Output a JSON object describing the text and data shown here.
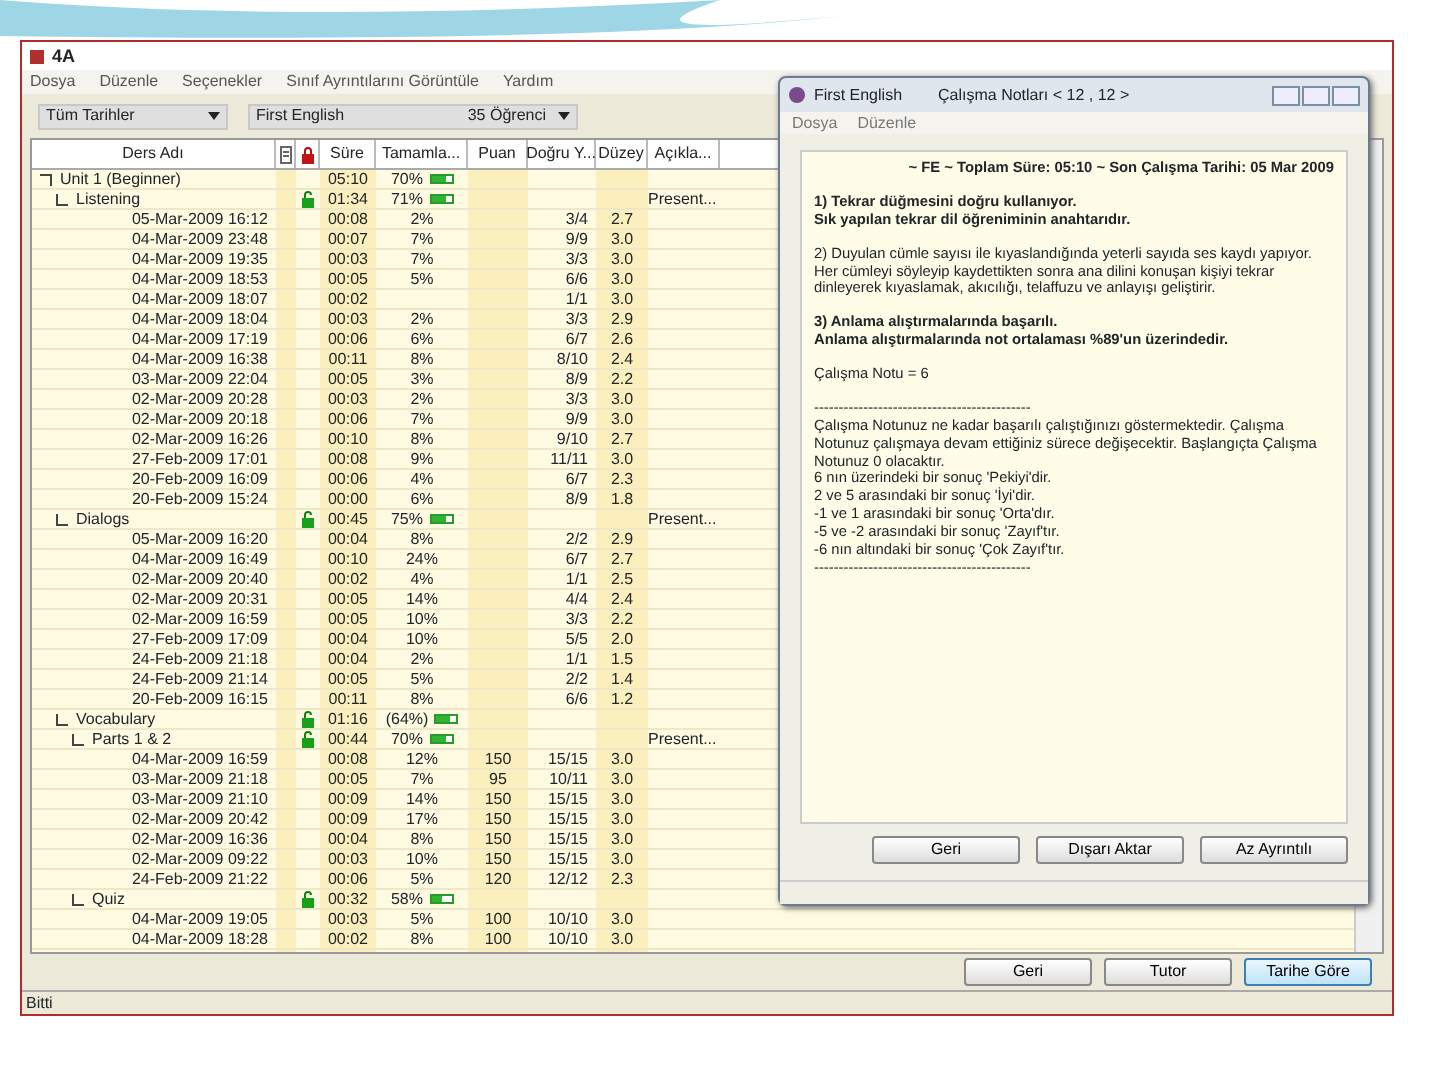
{
  "window": {
    "title": "4A",
    "menu": [
      "Dosya",
      "Düzenle",
      "Seçenekler",
      "Sınıf Ayrıntılarını Görüntüle",
      "Yardım"
    ],
    "filters": [
      {
        "value": "Tüm Tarihler"
      },
      {
        "value": "First English",
        "extra": "35 Öğrenci"
      }
    ],
    "table": {
      "columns": [
        {
          "kind": "text",
          "label": "Ders Adı"
        },
        {
          "kind": "notes"
        },
        {
          "kind": "lock"
        },
        {
          "kind": "text",
          "label": "Süre"
        },
        {
          "kind": "text",
          "label": "Tamamla..."
        },
        {
          "kind": "text",
          "label": "Puan"
        },
        {
          "kind": "text",
          "label": "Doğru Y..."
        },
        {
          "kind": "text",
          "label": "Düzey"
        },
        {
          "kind": "text",
          "label": "Açıkla..."
        }
      ],
      "rows": [
        {
          "kind": "group",
          "name": "Unit 1 (Beginner)",
          "padlock": false,
          "duration": "05:10",
          "complete": "70%",
          "level": 0.7,
          "children": [
            {
              "kind": "group",
              "name": "Listening",
              "padlock": true,
              "duration": "01:34",
              "complete": "71%",
              "level": 0.71,
              "description": "Present...",
              "children": [
                {
                  "kind": "session",
                  "date": "05-Mar-2009  16:12",
                  "duration": "00:08",
                  "complete": "2%",
                  "correct": "3/4",
                  "grade": "2.7"
                },
                {
                  "kind": "session",
                  "date": "04-Mar-2009  23:48",
                  "duration": "00:07",
                  "complete": "7%",
                  "correct": "9/9",
                  "grade": "3.0"
                },
                {
                  "kind": "session",
                  "date": "04-Mar-2009  19:35",
                  "duration": "00:03",
                  "complete": "7%",
                  "correct": "3/3",
                  "grade": "3.0"
                },
                {
                  "kind": "session",
                  "date": "04-Mar-2009  18:53",
                  "duration": "00:05",
                  "complete": "5%",
                  "correct": "6/6",
                  "grade": "3.0"
                },
                {
                  "kind": "session",
                  "date": "04-Mar-2009  18:07",
                  "duration": "00:02",
                  "correct": "1/1",
                  "grade": "3.0"
                },
                {
                  "kind": "session",
                  "date": "04-Mar-2009  18:04",
                  "duration": "00:03",
                  "complete": "2%",
                  "correct": "3/3",
                  "grade": "2.9"
                },
                {
                  "kind": "session",
                  "date": "04-Mar-2009  17:19",
                  "duration": "00:06",
                  "complete": "6%",
                  "correct": "6/7",
                  "grade": "2.6"
                },
                {
                  "kind": "session",
                  "date": "04-Mar-2009  16:38",
                  "duration": "00:11",
                  "complete": "8%",
                  "correct": "8/10",
                  "grade": "2.4"
                },
                {
                  "kind": "session",
                  "date": "03-Mar-2009  22:04",
                  "duration": "00:05",
                  "complete": "3%",
                  "correct": "8/9",
                  "grade": "2.2"
                },
                {
                  "kind": "session",
                  "date": "02-Mar-2009  20:28",
                  "duration": "00:03",
                  "complete": "2%",
                  "correct": "3/3",
                  "grade": "3.0"
                },
                {
                  "kind": "session",
                  "date": "02-Mar-2009  20:18",
                  "duration": "00:06",
                  "complete": "7%",
                  "correct": "9/9",
                  "grade": "3.0"
                },
                {
                  "kind": "session",
                  "date": "02-Mar-2009  16:26",
                  "duration": "00:10",
                  "complete": "8%",
                  "correct": "9/10",
                  "grade": "2.7"
                },
                {
                  "kind": "session",
                  "date": "27-Feb-2009  17:01",
                  "duration": "00:08",
                  "complete": "9%",
                  "correct": "11/11",
                  "grade": "3.0"
                },
                {
                  "kind": "session",
                  "date": "20-Feb-2009  16:09",
                  "duration": "00:06",
                  "complete": "4%",
                  "correct": "6/7",
                  "grade": "2.3"
                },
                {
                  "kind": "session",
                  "date": "20-Feb-2009  15:24",
                  "duration": "00:00",
                  "complete": "6%",
                  "correct": "8/9",
                  "grade": "1.8"
                }
              ]
            },
            {
              "kind": "group",
              "name": "Dialogs",
              "padlock": true,
              "duration": "00:45",
              "complete": "75%",
              "level": 0.75,
              "description": "Present...",
              "children": [
                {
                  "kind": "session",
                  "date": "05-Mar-2009  16:20",
                  "duration": "00:04",
                  "complete": "8%",
                  "correct": "2/2",
                  "grade": "2.9"
                },
                {
                  "kind": "session",
                  "date": "04-Mar-2009  16:49",
                  "duration": "00:10",
                  "complete": "24%",
                  "correct": "6/7",
                  "grade": "2.7"
                },
                {
                  "kind": "session",
                  "date": "02-Mar-2009  20:40",
                  "duration": "00:02",
                  "complete": "4%",
                  "correct": "1/1",
                  "grade": "2.5"
                },
                {
                  "kind": "session",
                  "date": "02-Mar-2009  20:31",
                  "duration": "00:05",
                  "complete": "14%",
                  "correct": "4/4",
                  "grade": "2.4"
                },
                {
                  "kind": "session",
                  "date": "02-Mar-2009  16:59",
                  "duration": "00:05",
                  "complete": "10%",
                  "correct": "3/3",
                  "grade": "2.2"
                },
                {
                  "kind": "session",
                  "date": "27-Feb-2009  17:09",
                  "duration": "00:04",
                  "complete": "10%",
                  "correct": "5/5",
                  "grade": "2.0"
                },
                {
                  "kind": "session",
                  "date": "24-Feb-2009  21:18",
                  "duration": "00:04",
                  "complete": "2%",
                  "correct": "1/1",
                  "grade": "1.5"
                },
                {
                  "kind": "session",
                  "date": "24-Feb-2009  21:14",
                  "duration": "00:05",
                  "complete": "5%",
                  "correct": "2/2",
                  "grade": "1.4"
                },
                {
                  "kind": "session",
                  "date": "20-Feb-2009  16:15",
                  "duration": "00:11",
                  "complete": "8%",
                  "correct": "6/6",
                  "grade": "1.2"
                }
              ]
            },
            {
              "kind": "group",
              "name": "Vocabulary",
              "padlock": true,
              "duration": "01:16",
              "complete": "(64%)",
              "level": 0.64,
              "children": [
                {
                  "kind": "group",
                  "name": "Parts 1 & 2",
                  "padlock": true,
                  "duration": "00:44",
                  "complete": "70%",
                  "level": 0.7,
                  "description": "Present...",
                  "children": [
                    {
                      "kind": "session",
                      "date": "04-Mar-2009  16:59",
                      "duration": "00:08",
                      "complete": "12%",
                      "score": "150",
                      "correct": "15/15",
                      "grade": "3.0"
                    },
                    {
                      "kind": "session",
                      "date": "03-Mar-2009  21:18",
                      "duration": "00:05",
                      "complete": "7%",
                      "score": "95",
                      "correct": "10/11",
                      "grade": "3.0"
                    },
                    {
                      "kind": "session",
                      "date": "03-Mar-2009  21:10",
                      "duration": "00:09",
                      "complete": "14%",
                      "score": "150",
                      "correct": "15/15",
                      "grade": "3.0"
                    },
                    {
                      "kind": "session",
                      "date": "02-Mar-2009  20:42",
                      "duration": "00:09",
                      "complete": "17%",
                      "score": "150",
                      "correct": "15/15",
                      "grade": "3.0"
                    },
                    {
                      "kind": "session",
                      "date": "02-Mar-2009  16:36",
                      "duration": "00:04",
                      "complete": "8%",
                      "score": "150",
                      "correct": "15/15",
                      "grade": "3.0"
                    },
                    {
                      "kind": "session",
                      "date": "02-Mar-2009  09:22",
                      "duration": "00:03",
                      "complete": "10%",
                      "score": "150",
                      "correct": "15/15",
                      "grade": "3.0"
                    },
                    {
                      "kind": "session",
                      "date": "24-Feb-2009  21:22",
                      "duration": "00:06",
                      "complete": "5%",
                      "score": "120",
                      "correct": "12/12",
                      "grade": "2.3"
                    }
                  ]
                },
                {
                  "kind": "group",
                  "name": "Quiz",
                  "padlock": true,
                  "duration": "00:32",
                  "complete": "58%",
                  "level": 0.58,
                  "children": [
                    {
                      "kind": "session",
                      "date": "04-Mar-2009  19:05",
                      "duration": "00:03",
                      "complete": "5%",
                      "score": "100",
                      "correct": "10/10",
                      "grade": "3.0"
                    },
                    {
                      "kind": "session",
                      "date": "04-Mar-2009  18:28",
                      "duration": "00:02",
                      "complete": "8%",
                      "score": "100",
                      "correct": "10/10",
                      "grade": "3.0"
                    }
                  ]
                }
              ]
            }
          ]
        }
      ]
    },
    "buttons": [
      {
        "label": "Geri",
        "selected": false
      },
      {
        "label": "Tutor",
        "selected": false
      },
      {
        "label": "Tarihe Göre",
        "selected": true
      }
    ],
    "status_bar": "Bitti"
  },
  "dialog": {
    "app_name": "First English",
    "title": "Çalışma Notları < 12 , 12 >",
    "menu": [
      "Dosya",
      "Düzenle"
    ],
    "header": "~ FE ~ Toplam Süre: 05:10 ~ Son Çalışma Tarihi: 05 Mar 2009",
    "paragraphs": [
      {
        "bold": true,
        "lines": [
          "1) Tekrar düğmesini doğru kullanıyor.",
          "Sık yapılan tekrar dil öğreniminin anahtarıdır."
        ]
      },
      {
        "bold": false,
        "lines": [
          "2) Duyulan cümle sayısı ile kıyaslandığında yeterli sayıda ses kaydı yapıyor.",
          "Her cümleyi söyleyip kaydettikten sonra ana dilini konuşan kişiyi tekrar dinleyerek kıyaslamak, akıcılığı, telaffuzu ve anlayışı geliştirir."
        ]
      },
      {
        "bold": true,
        "lines": [
          "3) Anlama alıştırmalarında başarılı.",
          "Anlama alıştırmalarında not ortalaması %89'un üzerindedir."
        ]
      },
      {
        "bold": false,
        "lines": [
          "Çalışma Notu = 6"
        ]
      },
      {
        "bold": false,
        "lines": [
          "--------------------------------------------",
          "Çalışma Notunuz ne kadar başarılı çalıştığınızı göstermektedir.  Çalışma Notunuz çalışmaya devam ettiğiniz sürece değişecektir.  Başlangıçta Çalışma Notunuz 0 olacaktır.",
          " 6 nın üzerindeki bir sonuç 'Pekiyi'dir.",
          " 2 ve 5 arasındaki bir sonuç 'İyi'dir.",
          "-1 ve 1 arasındaki bir sonuç 'Orta'dır.",
          "-5 ve -2 arasındaki bir sonuç 'Zayıf'tır.",
          "-6 nın altındaki bir sonuç 'Çok Zayıf'tır.",
          "--------------------------------------------"
        ]
      }
    ],
    "buttons": [
      "Geri",
      "Dışarı Aktar",
      "Az Ayrıntılı"
    ]
  }
}
